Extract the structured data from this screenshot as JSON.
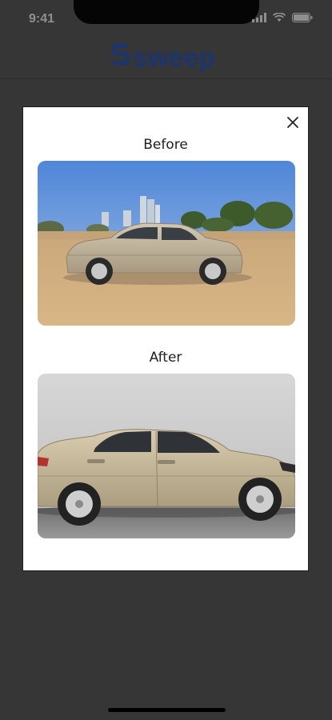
{
  "status_bar": {
    "time": "9:41",
    "icons": [
      "signal-icon",
      "wifi-icon",
      "battery-icon"
    ]
  },
  "header": {
    "logo_text": "sweep",
    "brand_color": "#1b3570"
  },
  "modal": {
    "close_icon": "close-icon",
    "before_label": "Before",
    "after_label": "After"
  },
  "colors": {
    "backdrop": "#363636",
    "modal_bg": "#ffffff",
    "car_body": "#b5a88e"
  }
}
